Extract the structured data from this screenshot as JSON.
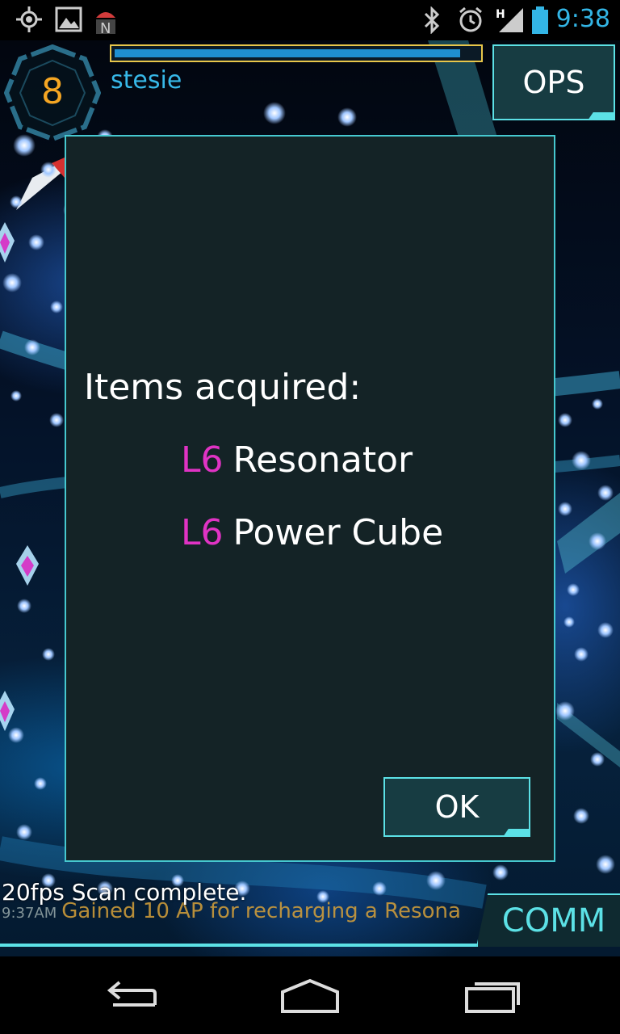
{
  "status_bar": {
    "time": "9:38",
    "icons": [
      "gps-icon",
      "image-notification-icon",
      "android-notification-icon",
      "bluetooth-icon",
      "alarm-icon",
      "signal-icon",
      "battery-icon"
    ],
    "network_label": "H"
  },
  "hud": {
    "level": "8",
    "agent_name": "stesie",
    "xp_progress": 0.95,
    "ops_label": "OPS"
  },
  "dialog": {
    "title": "Items acquired:",
    "items": [
      {
        "level": "L6",
        "name": "Resonator"
      },
      {
        "level": "L6",
        "name": "Power Cube"
      }
    ],
    "ok_label": "OK"
  },
  "bottom": {
    "fps_status": "20fps  Scan complete.",
    "ticker_time": "9:37AM",
    "ticker_text": "Gained 10 AP for recharging a Resona",
    "comm_label": "COMM"
  },
  "nav_bar": {
    "buttons": [
      "back-icon",
      "home-icon",
      "recents-icon"
    ]
  },
  "colors": {
    "accent": "#5ce1e6",
    "item_level": "#e033c4",
    "level_number": "#f5a623",
    "time": "#33b5e5",
    "ticker": "#d8a23a"
  }
}
